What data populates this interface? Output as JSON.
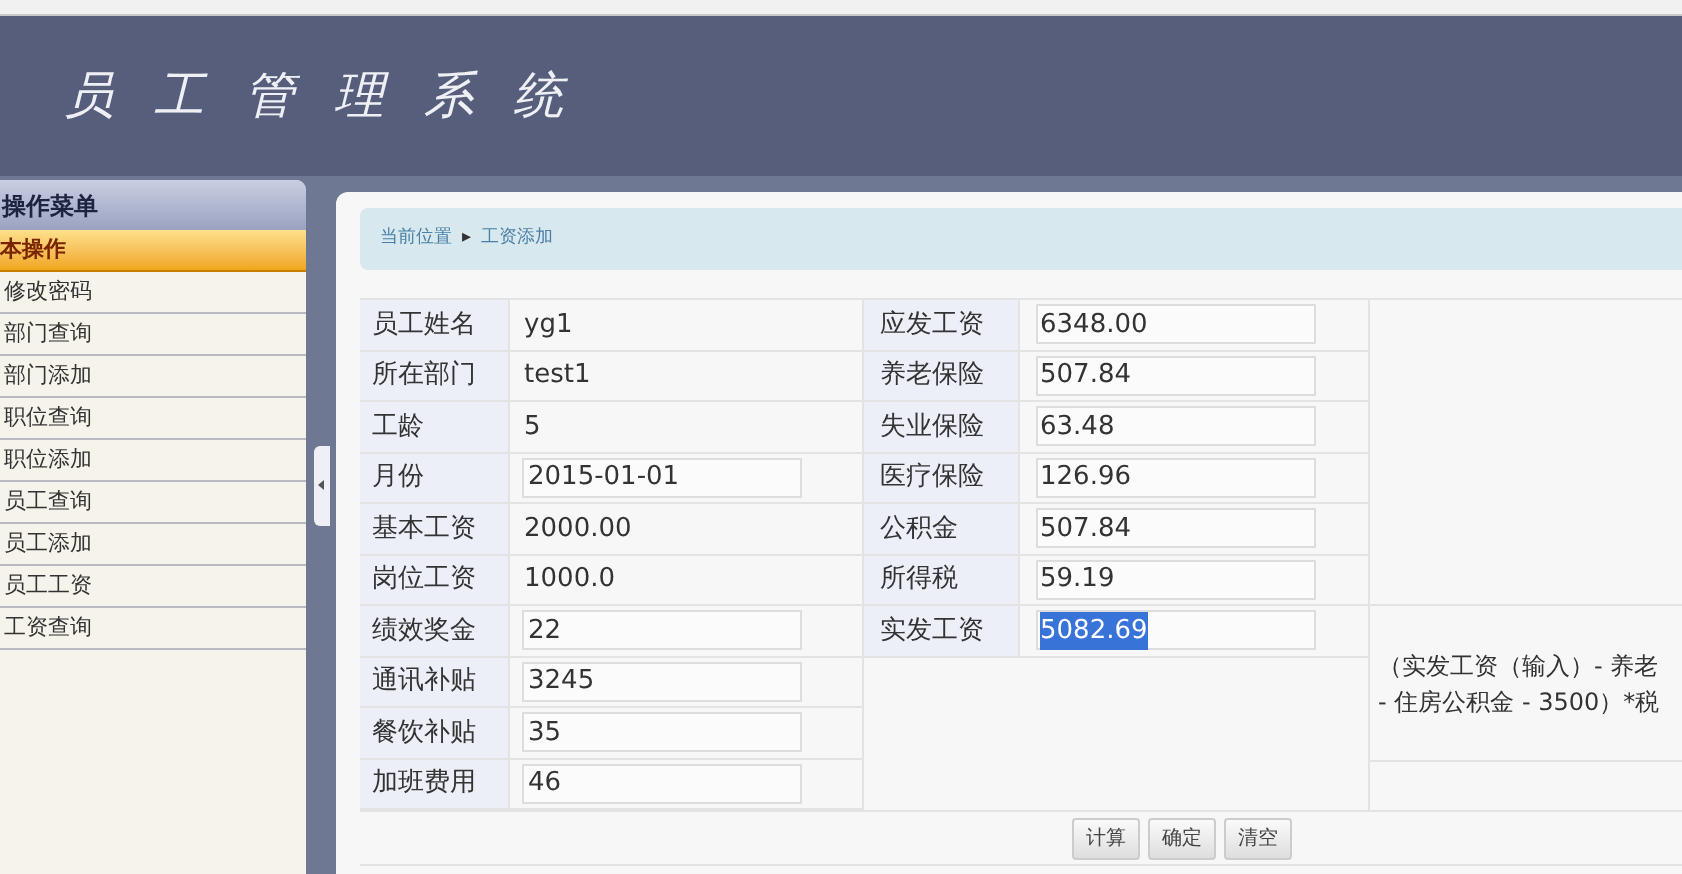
{
  "header": {
    "title": "员 工 管 理 系 统"
  },
  "sidebar": {
    "title": "操作菜单",
    "group": {
      "label": "本操作",
      "selected": true
    },
    "items": [
      "修改密码",
      "部门查询",
      "部门添加",
      "职位查询",
      "职位添加",
      "员工查询",
      "员工添加",
      "员工工资",
      "工资查询"
    ]
  },
  "breadcrumb": {
    "location": "当前位置",
    "arrow": "▸",
    "page": "工资添加"
  },
  "form": {
    "left": [
      {
        "label": "员工姓名",
        "value": "yg1",
        "kind": "text"
      },
      {
        "label": "所在部门",
        "value": "test1",
        "kind": "text"
      },
      {
        "label": "工龄",
        "value": "5",
        "kind": "text"
      },
      {
        "label": "月份",
        "value": "2015-01-01",
        "kind": "input"
      },
      {
        "label": "基本工资",
        "value": "2000.00",
        "kind": "text"
      },
      {
        "label": "岗位工资",
        "value": "1000.0",
        "kind": "text"
      },
      {
        "label": "绩效奖金",
        "value": "22",
        "kind": "input"
      },
      {
        "label": "通讯补贴",
        "value": "3245",
        "kind": "input"
      },
      {
        "label": "餐饮补贴",
        "value": "35",
        "kind": "input"
      },
      {
        "label": "加班费用",
        "value": "46",
        "kind": "input"
      }
    ],
    "right": [
      {
        "label": "应发工资",
        "value": "6348.00",
        "highlighted": false
      },
      {
        "label": "养老保险",
        "value": "507.84",
        "highlighted": false
      },
      {
        "label": "失业保险",
        "value": "63.48",
        "highlighted": false
      },
      {
        "label": "医疗保险",
        "value": "126.96",
        "highlighted": false
      },
      {
        "label": "公积金",
        "value": "507.84",
        "highlighted": false
      },
      {
        "label": "所得税",
        "value": "59.19",
        "highlighted": false
      },
      {
        "label": "实发工资",
        "value": "5082.69",
        "highlighted": true
      }
    ],
    "note": [
      "（实发工资（输入）- 养老",
      "- 住房公积金 - 3500）*税"
    ],
    "buttons": [
      "计算",
      "确定",
      "清空"
    ]
  }
}
